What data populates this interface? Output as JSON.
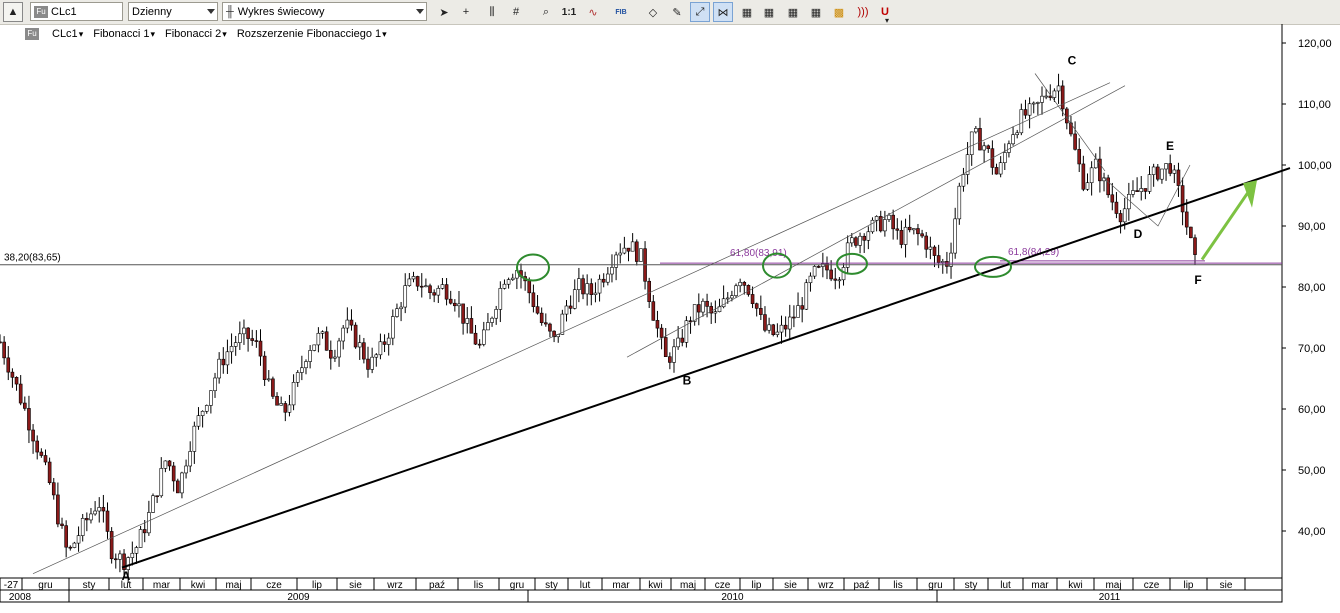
{
  "toolbar": {
    "symbol": "CLc1",
    "interval": "Dzienny",
    "chart_type": "Wykres świecowy",
    "symbol_badge": "Fu",
    "icons": [
      "arrow-up-icon",
      "cursor-icon",
      "crosshair-icon",
      "bar-chart-icon",
      "grid-icon",
      "zoom-icon",
      "one-to-one-icon",
      "wave-icon",
      "fib-icon",
      "eraser-icon",
      "label-icon",
      "trendline-icon",
      "pattern-icon",
      "chart-a-icon",
      "chart-b-icon",
      "chart-c-icon",
      "chart-d-icon",
      "chart-e-icon",
      "magnet-icon",
      "more-icon"
    ],
    "one_to_one": "1:1",
    "fib_label": "FIB"
  },
  "legend": {
    "badge": "Fu",
    "items": [
      "CLc1",
      "Fibonacci 1",
      "Fibonacci 2",
      "Rozszerzenie Fibonacciego 1"
    ]
  },
  "chart_data": {
    "type": "candlestick",
    "y_axis": {
      "min": 31,
      "max": 122,
      "ticks": [
        "120,00",
        "110,00",
        "100,00",
        "90,00",
        "80,00",
        "70,00",
        "60,00",
        "50,00",
        "40,00"
      ],
      "tick_values": [
        120,
        110,
        100,
        90,
        80,
        70,
        60,
        50,
        40
      ],
      "side": "right"
    },
    "x_axis": {
      "months": [
        "-27",
        "gru",
        "sty",
        "lut",
        "mar",
        "kwi",
        "maj",
        "cze",
        "lip",
        "sie",
        "wrz",
        "paź",
        "lis",
        "gru",
        "sty",
        "lut",
        "mar",
        "kwi",
        "maj",
        "cze",
        "lip",
        "sie",
        "wrz",
        "paź",
        "lis",
        "gru",
        "sty",
        "lut",
        "mar",
        "kwi",
        "maj",
        "cze",
        "lip",
        "sie"
      ],
      "years": [
        "2008",
        "2009",
        "2010",
        "2011"
      ]
    },
    "price_path": [
      [
        0,
        71
      ],
      [
        4,
        60
      ],
      [
        8,
        48
      ],
      [
        11,
        36
      ],
      [
        13,
        40
      ],
      [
        16,
        45
      ],
      [
        18,
        37
      ],
      [
        20,
        35
      ],
      [
        22,
        37
      ],
      [
        24,
        42
      ],
      [
        27,
        52
      ],
      [
        29,
        47
      ],
      [
        31,
        55
      ],
      [
        34,
        63
      ],
      [
        36,
        68
      ],
      [
        38,
        71
      ],
      [
        40,
        72
      ],
      [
        42,
        70
      ],
      [
        44,
        62
      ],
      [
        46,
        59
      ],
      [
        48,
        64
      ],
      [
        50,
        70
      ],
      [
        52,
        72
      ],
      [
        54,
        69
      ],
      [
        56,
        74
      ],
      [
        58,
        71
      ],
      [
        60,
        67
      ],
      [
        62,
        70
      ],
      [
        64,
        75
      ],
      [
        66,
        80
      ],
      [
        68,
        81
      ],
      [
        70,
        79
      ],
      [
        72,
        80
      ],
      [
        74,
        78
      ],
      [
        76,
        73
      ],
      [
        78,
        70
      ],
      [
        80,
        76
      ],
      [
        82,
        82
      ],
      [
        84,
        83
      ],
      [
        86,
        79
      ],
      [
        88,
        74
      ],
      [
        90,
        71
      ],
      [
        92,
        77
      ],
      [
        94,
        80
      ],
      [
        96,
        79
      ],
      [
        98,
        82
      ],
      [
        100,
        86
      ],
      [
        102,
        87
      ],
      [
        104,
        85
      ],
      [
        106,
        76
      ],
      [
        108,
        68
      ],
      [
        110,
        70
      ],
      [
        112,
        75
      ],
      [
        114,
        77
      ],
      [
        116,
        75
      ],
      [
        118,
        78
      ],
      [
        120,
        82
      ],
      [
        122,
        79
      ],
      [
        124,
        73
      ],
      [
        126,
        72
      ],
      [
        128,
        74
      ],
      [
        130,
        77
      ],
      [
        132,
        82
      ],
      [
        134,
        83
      ],
      [
        136,
        82
      ],
      [
        138,
        87
      ],
      [
        140,
        89
      ],
      [
        142,
        90
      ],
      [
        144,
        91
      ],
      [
        146,
        88
      ],
      [
        148,
        89
      ],
      [
        150,
        88
      ],
      [
        152,
        84
      ],
      [
        154,
        84
      ],
      [
        156,
        98
      ],
      [
        158,
        105
      ],
      [
        160,
        103
      ],
      [
        162,
        98
      ],
      [
        164,
        105
      ],
      [
        166,
        108
      ],
      [
        168,
        109
      ],
      [
        170,
        112
      ],
      [
        172,
        113
      ],
      [
        174,
        104
      ],
      [
        176,
        97
      ],
      [
        178,
        100
      ],
      [
        180,
        95
      ],
      [
        182,
        92
      ],
      [
        184,
        95
      ],
      [
        186,
        97
      ],
      [
        188,
        99
      ],
      [
        190,
        100
      ],
      [
        192,
        93
      ],
      [
        194,
        84
      ]
    ],
    "horizontal_levels": [
      {
        "label": "38,20(83,65)",
        "value": 83.65,
        "color": "#555555"
      },
      {
        "label": "61,80(83,91)",
        "value": 83.91,
        "color": "#8b3a9c"
      },
      {
        "label": "61,8(84,29)",
        "value": 84.29,
        "color": "#8b3a9c"
      }
    ],
    "points": [
      {
        "label": "A",
        "value": 34
      },
      {
        "label": "B",
        "value": 65
      },
      {
        "label": "C",
        "value": 114
      },
      {
        "label": "D",
        "value": 90
      },
      {
        "label": "E",
        "value": 100
      },
      {
        "label": "F",
        "value": 83
      }
    ],
    "circles": 5,
    "arrow_color": "#7dc242",
    "circle_color": "#2e8b2e"
  }
}
